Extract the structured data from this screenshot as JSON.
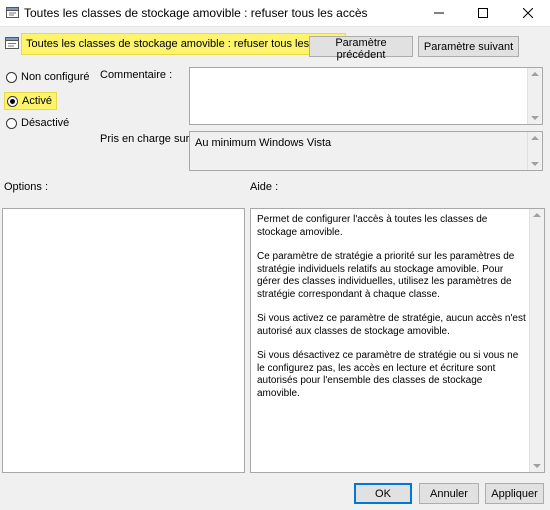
{
  "window": {
    "title": "Toutes les classes de stockage amovible : refuser tous les accès",
    "icons": {
      "app": "policy-icon",
      "minimize": "minimize-icon",
      "maximize": "maximize-icon",
      "close": "close-icon"
    }
  },
  "header": {
    "setting_name": "Toutes les classes de stockage amovible : refuser tous les accès",
    "prev_button": "Paramètre précédent",
    "next_button": "Paramètre suivant"
  },
  "state": {
    "options": [
      {
        "label": "Non configuré",
        "checked": false
      },
      {
        "label": "Activé",
        "checked": true
      },
      {
        "label": "Désactivé",
        "checked": false
      }
    ]
  },
  "comment": {
    "label": "Commentaire :",
    "value": ""
  },
  "supported": {
    "label": "Pris en charge sur :",
    "value": "Au minimum Windows Vista"
  },
  "options_panel": {
    "label": "Options :"
  },
  "help_panel": {
    "label": "Aide :",
    "paragraphs": [
      "Permet de configurer l'accès à toutes les classes de stockage amovible.",
      "Ce paramètre de stratégie a priorité sur les paramètres de stratégie individuels relatifs au stockage amovible. Pour gérer des classes individuelles, utilisez les paramètres de stratégie correspondant à chaque classe.",
      "Si vous activez ce paramètre de stratégie, aucun accès n'est autorisé aux classes de stockage amovible.",
      "Si vous désactivez ce paramètre de stratégie ou si vous ne le configurez pas, les accès en lecture et écriture sont autorisés pour l'ensemble des classes de stockage amovible."
    ]
  },
  "footer": {
    "ok": "OK",
    "cancel": "Annuler",
    "apply": "Appliquer"
  },
  "colors": {
    "highlight": "#fdf46b",
    "accent": "#0078d7"
  }
}
